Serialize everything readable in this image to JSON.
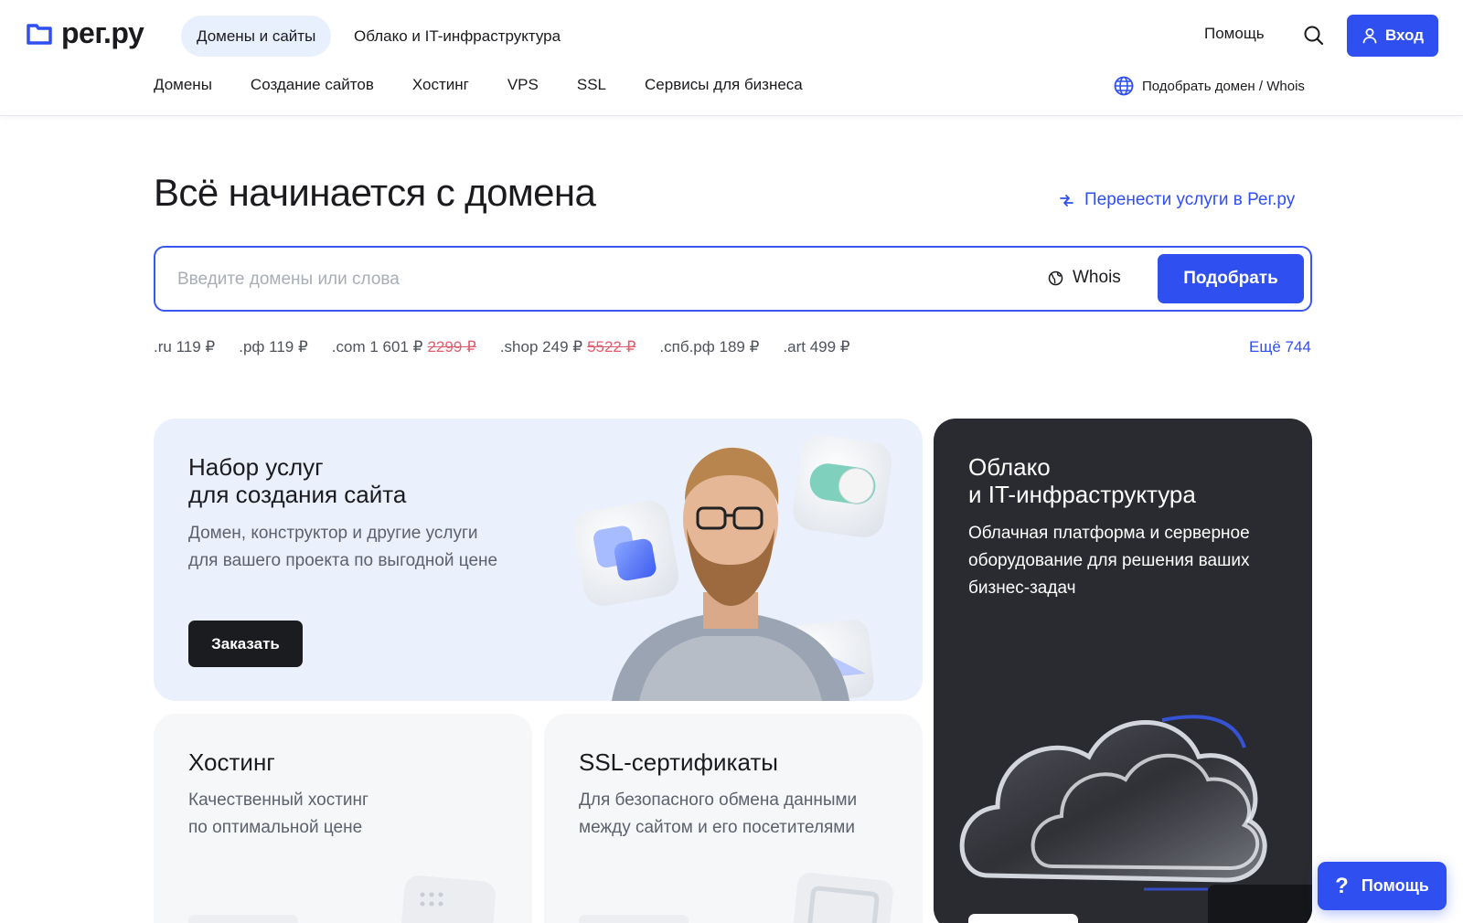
{
  "header": {
    "logo_text": "рег.ру",
    "top_tabs": [
      {
        "label": "Домены и сайты",
        "active": true
      },
      {
        "label": "Облако и IT-инфраструктура",
        "active": false
      }
    ],
    "help_label": "Помощь",
    "login_label": "Вход",
    "nav": [
      "Домены",
      "Создание сайтов",
      "Хостинг",
      "VPS",
      "SSL",
      "Сервисы для бизнеса"
    ],
    "whois_link": "Подобрать домен / Whois"
  },
  "hero": {
    "title": "Всё начинается с домена",
    "transfer_link": "Перенести услуги в Рег.ру",
    "search": {
      "placeholder": "Введите домены или слова",
      "value": "",
      "whois_label": "Whois",
      "button_label": "Подобрать"
    },
    "prices": [
      {
        "zone": ".ru",
        "price": "119 ₽",
        "old": ""
      },
      {
        "zone": ".рф",
        "price": "119 ₽",
        "old": ""
      },
      {
        "zone": ".com",
        "price": "1 601 ₽",
        "old": "2299 ₽"
      },
      {
        "zone": ".shop",
        "price": "249 ₽",
        "old": "5522 ₽"
      },
      {
        "zone": ".спб.рф",
        "price": "189 ₽",
        "old": ""
      },
      {
        "zone": ".art",
        "price": "499 ₽",
        "old": ""
      }
    ],
    "more_label": "Ещё 744"
  },
  "cards": {
    "site": {
      "title_line1": "Набор услуг",
      "title_line2": "для создания сайта",
      "desc_line1": "Домен, конструктор и другие услуги",
      "desc_line2": "для вашего проекта по выгодной цене",
      "button_label": "Заказать"
    },
    "cloud": {
      "title_line1": "Облако",
      "title_line2": "и IT-инфраструктура",
      "desc_line1": "Облачная платформа и серверное",
      "desc_line2": "оборудование для решения ваших",
      "desc_line3": "бизнес-задач"
    },
    "hosting": {
      "title": "Хостинг",
      "desc_line1": "Качественный хостинг",
      "desc_line2": "по оптимальной цене"
    },
    "ssl": {
      "title": "SSL-сертификаты",
      "desc_line1": "Для безопасного обмена данными",
      "desc_line2": "между сайтом и его посетителями"
    }
  },
  "float_help": {
    "label": "Помощь",
    "icon": "?"
  },
  "colors": {
    "accent": "#2f4ff0",
    "site_card_bg": "#eaf1fd",
    "cloud_card_bg": "#2a2b30",
    "dark_button": "#1b1c20",
    "old_price": "#e25d6d"
  }
}
